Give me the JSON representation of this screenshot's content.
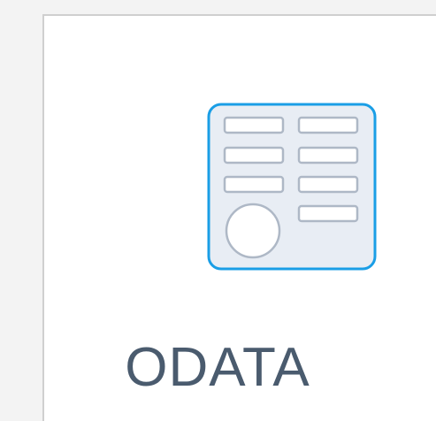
{
  "card": {
    "label": "ODATA",
    "icon": "odata-form-icon"
  },
  "colors": {
    "page_background": "#f3f3f3",
    "card_background": "#ffffff",
    "card_border": "#cfcfcf",
    "icon_border": "#1a9ee6",
    "icon_fill": "#e8edf4",
    "icon_shapes_stroke": "#aeb8c6",
    "label_text": "#4a5b6e"
  }
}
